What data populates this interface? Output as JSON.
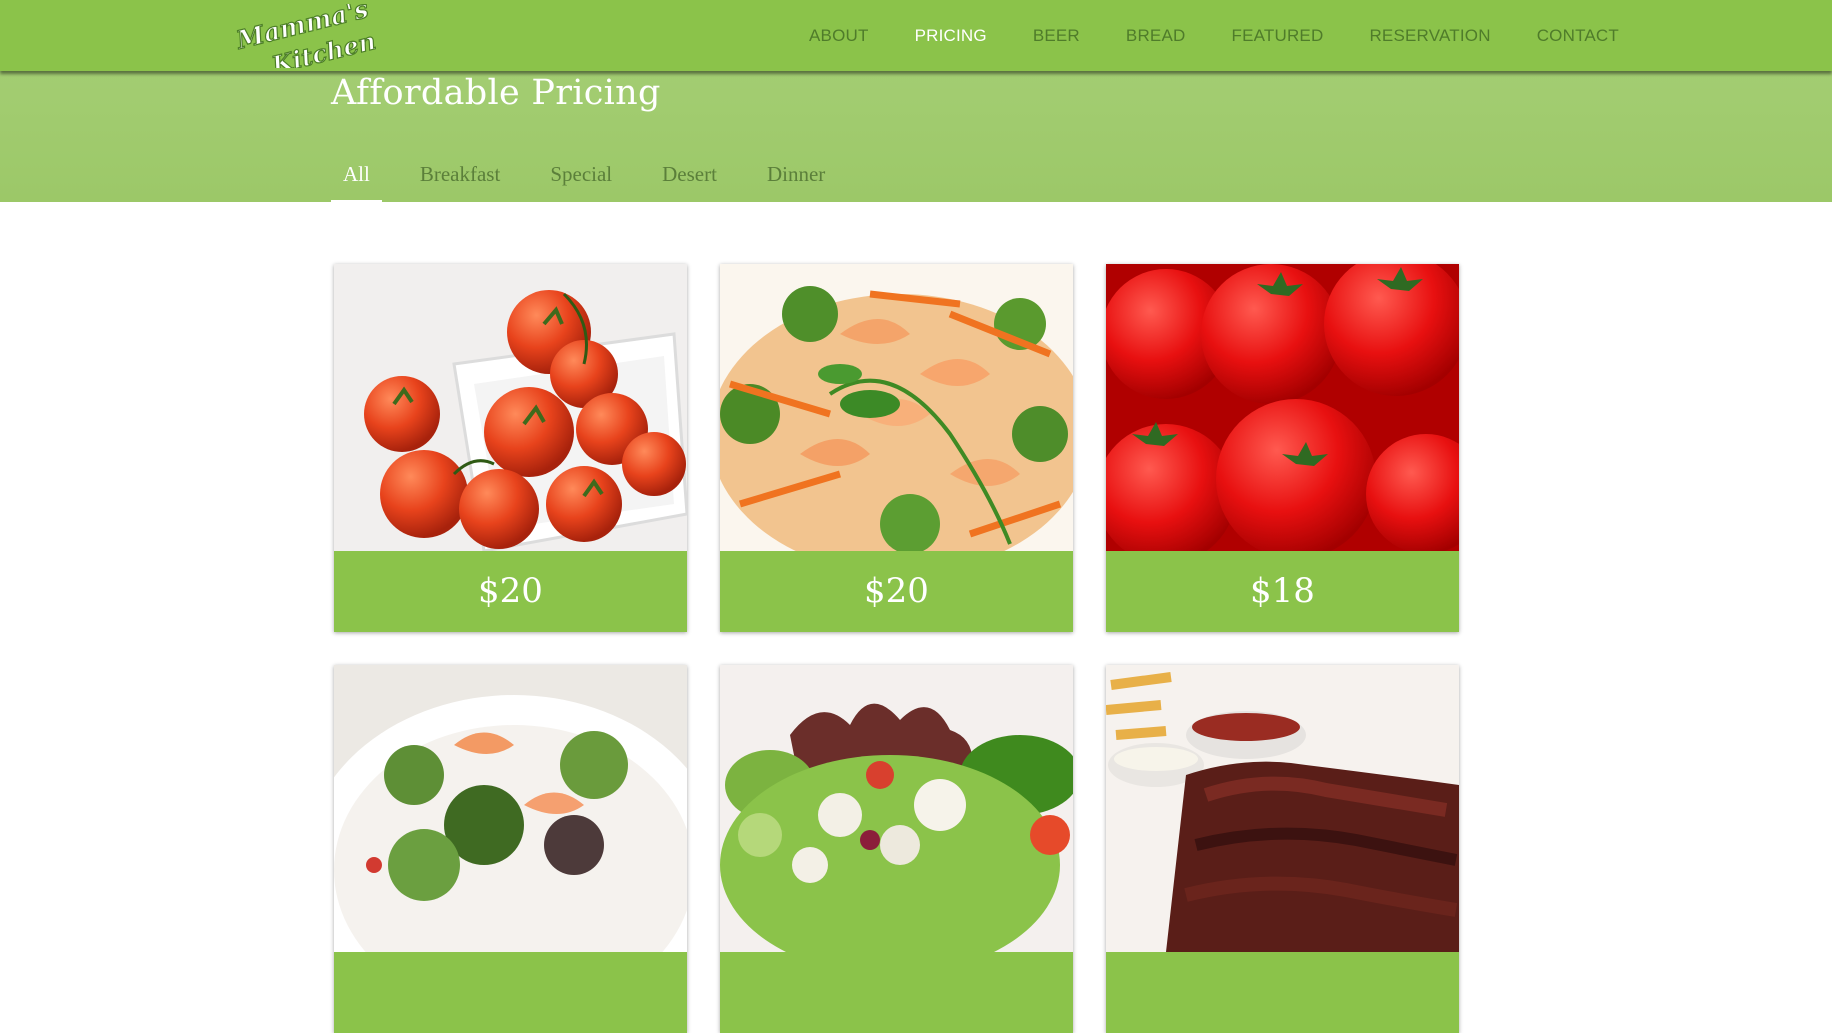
{
  "brand": {
    "logo_line1": "Mamma's",
    "logo_line2": "Kitchen"
  },
  "nav": {
    "items": [
      {
        "label": "ABOUT"
      },
      {
        "label": "PRICING",
        "active": true
      },
      {
        "label": "BEER"
      },
      {
        "label": "BREAD"
      },
      {
        "label": "FEATURED"
      },
      {
        "label": "RESERVATION"
      },
      {
        "label": "CONTACT"
      }
    ]
  },
  "hero": {
    "title": "Affordable Pricing",
    "tabs": [
      {
        "label": "All",
        "active": true
      },
      {
        "label": "Breakfast"
      },
      {
        "label": "Special"
      },
      {
        "label": "Desert"
      },
      {
        "label": "Dinner"
      }
    ]
  },
  "menu": {
    "items": [
      {
        "image": "cherry-tomatoes-bowl",
        "price": "$20"
      },
      {
        "image": "shrimp-stir-fry",
        "price": "$20"
      },
      {
        "image": "red-tomatoes",
        "price": "$18"
      },
      {
        "image": "shrimp-salad",
        "price": ""
      },
      {
        "image": "feta-salad",
        "price": ""
      },
      {
        "image": "bbq-ribs-with-sauces",
        "price": ""
      }
    ]
  },
  "colors": {
    "primary": "#8bc34a",
    "hero": "#a3cd72",
    "inactive_text": "#4f7c2a",
    "active_text": "#ffffff"
  }
}
